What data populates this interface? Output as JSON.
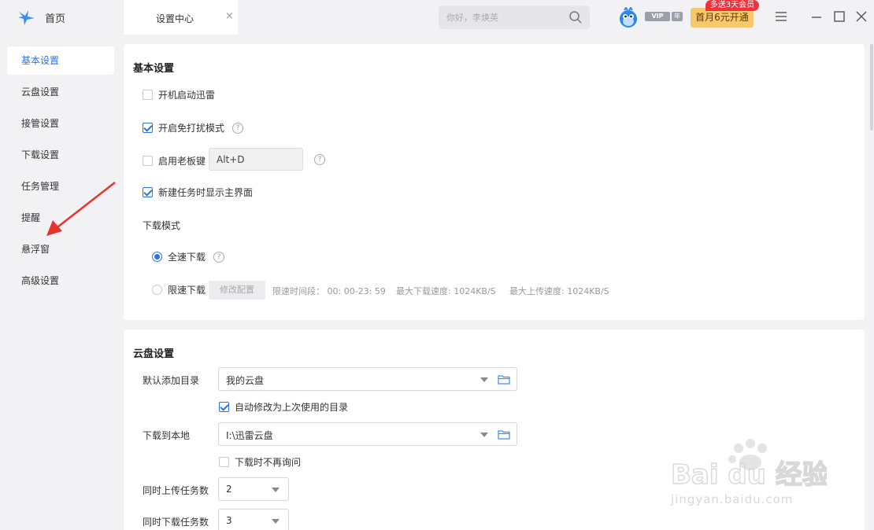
{
  "titlebar": {
    "home_label": "首页",
    "tab_label": "设置中心",
    "tab_close": "×",
    "search_placeholder": "你好，李焕英",
    "vip_label": "VIP",
    "year_label": "年",
    "promo_badge": "多送3天会员",
    "promo_button": "首月6元开通"
  },
  "sidebar": {
    "items": [
      {
        "label": "基本设置",
        "active": true
      },
      {
        "label": "云盘设置"
      },
      {
        "label": "接管设置"
      },
      {
        "label": "下载设置"
      },
      {
        "label": "任务管理"
      },
      {
        "label": "提醒"
      },
      {
        "label": "悬浮窗"
      },
      {
        "label": "高级设置"
      }
    ]
  },
  "basic": {
    "title": "基本设置",
    "autostart": {
      "label": "开机启动迅雷",
      "checked": false
    },
    "dnd": {
      "label": "开启免打扰模式",
      "checked": true
    },
    "boss_key": {
      "label": "启用老板键",
      "checked": false,
      "value": "Alt+D"
    },
    "show_main": {
      "label": "新建任务时显示主界面",
      "checked": true
    },
    "mode_title": "下载模式",
    "full_speed": {
      "label": "全速下载",
      "checked": true
    },
    "limited": {
      "label": "限速下载",
      "checked": false
    },
    "modify_btn": "修改配置",
    "limit_time": "限速时间段：  00: 00-23: 59",
    "max_down": "最大下载速度: 1024KB/S",
    "max_up": "最大上传速度: 1024KB/S"
  },
  "cloud": {
    "title": "云盘设置",
    "default_dir_label": "默认添加目录",
    "default_dir_value": "我的云盘",
    "auto_modify": {
      "label": "自动修改为上次使用的目录",
      "checked": true
    },
    "local_label": "下载到本地",
    "local_value": "I:\\迅雷云盘",
    "no_ask": {
      "label": "下载时不再询问",
      "checked": false
    },
    "upload_count_label": "同时上传任务数",
    "upload_count_value": "2",
    "download_count_label": "同时下载任务数",
    "download_count_value": "3"
  },
  "watermark": {
    "brand": "Bai du 经验",
    "url": "jingyan.baidu.com"
  },
  "colors": {
    "accent": "#2a73e8",
    "arrow": "#e8322e",
    "promo": "#f9c86a",
    "badge": "#f2323a"
  }
}
